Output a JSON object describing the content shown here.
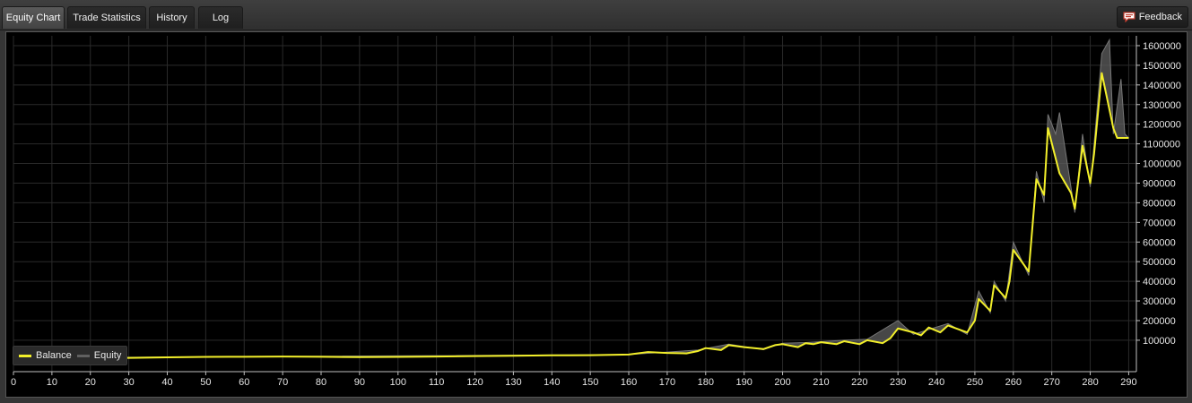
{
  "tabs": [
    {
      "label": "Equity Chart",
      "active": true
    },
    {
      "label": "Trade Statistics",
      "active": false
    },
    {
      "label": "History",
      "active": false
    },
    {
      "label": "Log",
      "active": false
    }
  ],
  "feedback": {
    "label": "Feedback",
    "icon": "speech-bubble-icon"
  },
  "colors": {
    "balance": "#f2ef2a",
    "equity": "#5f5f5f",
    "background": "#000000",
    "grid": "#2a2a2a",
    "axis_text": "#e6e6e6"
  },
  "chart_data": {
    "type": "line",
    "legend_position": "bottom-left",
    "grid": true,
    "xlim": [
      0,
      292
    ],
    "ylim": [
      -60000,
      1650000
    ],
    "x_ticks": [
      0,
      10,
      20,
      30,
      40,
      50,
      60,
      70,
      80,
      90,
      100,
      110,
      120,
      130,
      140,
      150,
      160,
      170,
      180,
      190,
      200,
      210,
      220,
      230,
      240,
      250,
      260,
      270,
      280,
      290
    ],
    "y_ticks": [
      100000,
      200000,
      300000,
      400000,
      500000,
      600000,
      700000,
      800000,
      900000,
      1000000,
      1100000,
      1200000,
      1300000,
      1400000,
      1500000,
      1600000
    ],
    "series": [
      {
        "name": "Balance",
        "color": "#f2ef2a",
        "points": [
          [
            0,
            10000
          ],
          [
            10,
            10000
          ],
          [
            20,
            10000
          ],
          [
            30,
            10000
          ],
          [
            40,
            13000
          ],
          [
            50,
            15000
          ],
          [
            60,
            16000
          ],
          [
            70,
            17000
          ],
          [
            80,
            16000
          ],
          [
            90,
            14000
          ],
          [
            100,
            15000
          ],
          [
            110,
            17000
          ],
          [
            120,
            19000
          ],
          [
            130,
            21000
          ],
          [
            140,
            23000
          ],
          [
            150,
            24000
          ],
          [
            160,
            27000
          ],
          [
            165,
            40000
          ],
          [
            170,
            35000
          ],
          [
            175,
            33000
          ],
          [
            178,
            45000
          ],
          [
            180,
            60000
          ],
          [
            184,
            50000
          ],
          [
            186,
            75000
          ],
          [
            190,
            65000
          ],
          [
            195,
            55000
          ],
          [
            198,
            75000
          ],
          [
            200,
            80000
          ],
          [
            204,
            65000
          ],
          [
            206,
            85000
          ],
          [
            208,
            80000
          ],
          [
            210,
            90000
          ],
          [
            214,
            80000
          ],
          [
            216,
            95000
          ],
          [
            220,
            80000
          ],
          [
            222,
            100000
          ],
          [
            226,
            85000
          ],
          [
            228,
            110000
          ],
          [
            230,
            160000
          ],
          [
            234,
            140000
          ],
          [
            236,
            125000
          ],
          [
            238,
            165000
          ],
          [
            241,
            140000
          ],
          [
            243,
            175000
          ],
          [
            248,
            140000
          ],
          [
            250,
            200000
          ],
          [
            251,
            310000
          ],
          [
            254,
            250000
          ],
          [
            255,
            380000
          ],
          [
            258,
            315000
          ],
          [
            259,
            400000
          ],
          [
            260,
            560000
          ],
          [
            264,
            450000
          ],
          [
            266,
            920000
          ],
          [
            268,
            840000
          ],
          [
            269,
            1180000
          ],
          [
            272,
            950000
          ],
          [
            275,
            850000
          ],
          [
            276,
            770000
          ],
          [
            278,
            1090000
          ],
          [
            280,
            900000
          ],
          [
            281,
            1050000
          ],
          [
            283,
            1460000
          ],
          [
            286,
            1180000
          ],
          [
            287,
            1130000
          ],
          [
            290,
            1130000
          ]
        ]
      },
      {
        "name": "Equity",
        "color": "#5f5f5f",
        "points": [
          [
            0,
            10000
          ],
          [
            160,
            27000
          ],
          [
            178,
            50000
          ],
          [
            186,
            80000
          ],
          [
            195,
            52000
          ],
          [
            200,
            85000
          ],
          [
            206,
            88000
          ],
          [
            216,
            100000
          ],
          [
            222,
            105000
          ],
          [
            230,
            200000
          ],
          [
            234,
            130000
          ],
          [
            243,
            185000
          ],
          [
            248,
            130000
          ],
          [
            251,
            350000
          ],
          [
            254,
            240000
          ],
          [
            255,
            400000
          ],
          [
            258,
            300000
          ],
          [
            260,
            600000
          ],
          [
            264,
            430000
          ],
          [
            266,
            960000
          ],
          [
            268,
            800000
          ],
          [
            269,
            1250000
          ],
          [
            271,
            1150000
          ],
          [
            272,
            1260000
          ],
          [
            276,
            750000
          ],
          [
            278,
            1150000
          ],
          [
            280,
            880000
          ],
          [
            281,
            1100000
          ],
          [
            283,
            1560000
          ],
          [
            285,
            1630000
          ],
          [
            286,
            1150000
          ],
          [
            288,
            1430000
          ],
          [
            289,
            1150000
          ],
          [
            290,
            1130000
          ]
        ]
      }
    ]
  }
}
